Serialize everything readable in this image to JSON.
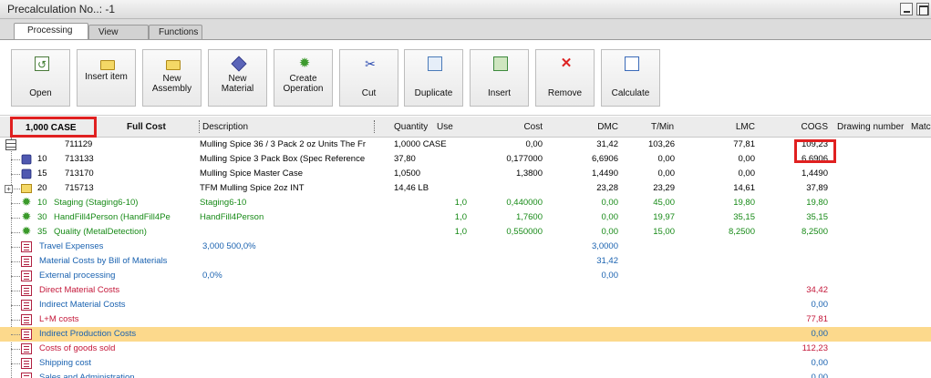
{
  "window": {
    "title": "Precalculation No..: -1"
  },
  "tabs": [
    "Processing",
    "View",
    "Functions"
  ],
  "toolbar": [
    {
      "label": "Open",
      "icon": "open-icon"
    },
    {
      "label": "Insert item",
      "icon": "folder-icon"
    },
    {
      "label": "New Assembly",
      "icon": "folder-icon"
    },
    {
      "label": "New Material",
      "icon": "cube-icon"
    },
    {
      "label": "Create Operation",
      "icon": "gear-icon"
    },
    {
      "label": "Cut",
      "icon": "scissors-icon"
    },
    {
      "label": "Duplicate",
      "icon": "duplicate-icon"
    },
    {
      "label": "Insert",
      "icon": "insert-icon"
    },
    {
      "label": "Remove",
      "icon": "remove-icon"
    },
    {
      "label": "Calculate",
      "icon": "calculate-icon"
    }
  ],
  "header": {
    "qty_label": "1,000 CASE",
    "full_cost": "Full Cost",
    "description": "Description",
    "quantity": "Quantity",
    "use": "Use",
    "cost": "Cost",
    "dmc": "DMC",
    "tmin": "T/Min",
    "lmc": "LMC",
    "cogs": "COGS",
    "drawing": "Drawing number",
    "match": "Matc"
  },
  "rows": [
    {
      "kind": "root",
      "no": "",
      "code": "711129",
      "desc": "Mulling Spice 36 / 3 Pack 2 oz Units The Fr",
      "qty": "1,0000 CASE",
      "use": "",
      "cost": "0,00",
      "dmc": "31,42",
      "tmin": "103,26",
      "lmc": "77,81",
      "cogs": "109,23",
      "color": "black"
    },
    {
      "kind": "cube",
      "no": "10",
      "code": "713133",
      "desc": "Mulling Spice 3 Pack Box (Spec Reference",
      "qty": "37,80",
      "use": "",
      "cost": "0,177000",
      "dmc": "6,6906",
      "tmin": "0,00",
      "lmc": "0,00",
      "cogs": "6,6906",
      "color": "black"
    },
    {
      "kind": "cube",
      "no": "15",
      "code": "713170",
      "desc": "Mulling Spice Master Case",
      "qty": "1,0500",
      "use": "",
      "cost": "1,3800",
      "dmc": "1,4490",
      "tmin": "0,00",
      "lmc": "0,00",
      "cogs": "1,4490",
      "color": "black"
    },
    {
      "kind": "folder",
      "no": "20",
      "code": "715713",
      "desc": "TFM Mulling Spice 2oz INT",
      "qty": "14,46 LB",
      "use": "",
      "cost": "",
      "dmc": "23,28",
      "tmin": "23,29",
      "lmc": "14,61",
      "cogs": "37,89",
      "color": "black"
    },
    {
      "kind": "gear",
      "no": "10",
      "code": "Staging (Staging6-10)",
      "desc": "Staging6-10",
      "qty": "",
      "use": "1,0",
      "cost": "0,440000",
      "dmc": "0,00",
      "tmin": "45,00",
      "lmc": "19,80",
      "cogs": "19,80",
      "color": "green"
    },
    {
      "kind": "gear",
      "no": "30",
      "code": "HandFill4Person (HandFill4Pe",
      "desc": "HandFill4Person",
      "qty": "",
      "use": "1,0",
      "cost": "1,7600",
      "dmc": "0,00",
      "tmin": "19,97",
      "lmc": "35,15",
      "cogs": "35,15",
      "color": "green"
    },
    {
      "kind": "gear",
      "no": "35",
      "code": "Quality (MetalDetection)",
      "desc": "",
      "qty": "",
      "use": "1,0",
      "cost": "0,550000",
      "dmc": "0,00",
      "tmin": "15,00",
      "lmc": "8,2500",
      "cogs": "8,2500",
      "color": "green"
    },
    {
      "kind": "page",
      "no": "",
      "code": "Travel Expenses",
      "desc": "3,000 500,0%",
      "qty": "",
      "use": "",
      "cost": "",
      "dmc": "3,0000",
      "tmin": "",
      "lmc": "",
      "cogs": "",
      "color": "blue"
    },
    {
      "kind": "page",
      "no": "",
      "code": "Material Costs by Bill of Materials",
      "desc": "",
      "qty": "",
      "use": "",
      "cost": "",
      "dmc": "31,42",
      "tmin": "",
      "lmc": "",
      "cogs": "",
      "color": "blue"
    },
    {
      "kind": "page",
      "no": "",
      "code": "External processing",
      "desc": "0,0%",
      "qty": "",
      "use": "",
      "cost": "",
      "dmc": "0,00",
      "tmin": "",
      "lmc": "",
      "cogs": "",
      "color": "blue"
    },
    {
      "kind": "page",
      "no": "",
      "code": "Direct Material Costs",
      "desc": "",
      "qty": "",
      "use": "",
      "cost": "",
      "dmc": "",
      "tmin": "",
      "lmc": "",
      "cogs": "34,42",
      "color": "red"
    },
    {
      "kind": "page",
      "no": "",
      "code": "Indirect Material Costs",
      "desc": "",
      "qty": "",
      "use": "",
      "cost": "",
      "dmc": "",
      "tmin": "",
      "lmc": "",
      "cogs": "0,00",
      "color": "blue"
    },
    {
      "kind": "page",
      "no": "",
      "code": "L+M costs",
      "desc": "",
      "qty": "",
      "use": "",
      "cost": "",
      "dmc": "",
      "tmin": "",
      "lmc": "",
      "cogs": "77,81",
      "color": "red"
    },
    {
      "kind": "page",
      "no": "",
      "code": "Indirect Production Costs",
      "desc": "",
      "qty": "",
      "use": "",
      "cost": "",
      "dmc": "",
      "tmin": "",
      "lmc": "",
      "cogs": "0,00",
      "color": "blue",
      "highlight": true
    },
    {
      "kind": "page",
      "no": "",
      "code": "Costs of goods sold",
      "desc": "",
      "qty": "",
      "use": "",
      "cost": "",
      "dmc": "",
      "tmin": "",
      "lmc": "",
      "cogs": "112,23",
      "color": "red"
    },
    {
      "kind": "page",
      "no": "",
      "code": "Shipping cost",
      "desc": "",
      "qty": "",
      "use": "",
      "cost": "",
      "dmc": "",
      "tmin": "",
      "lmc": "",
      "cogs": "0,00",
      "color": "blue"
    },
    {
      "kind": "page",
      "no": "",
      "code": "Sales and Administration",
      "desc": "",
      "qty": "",
      "use": "",
      "cost": "",
      "dmc": "",
      "tmin": "",
      "lmc": "",
      "cogs": "0,00",
      "color": "blue"
    }
  ]
}
